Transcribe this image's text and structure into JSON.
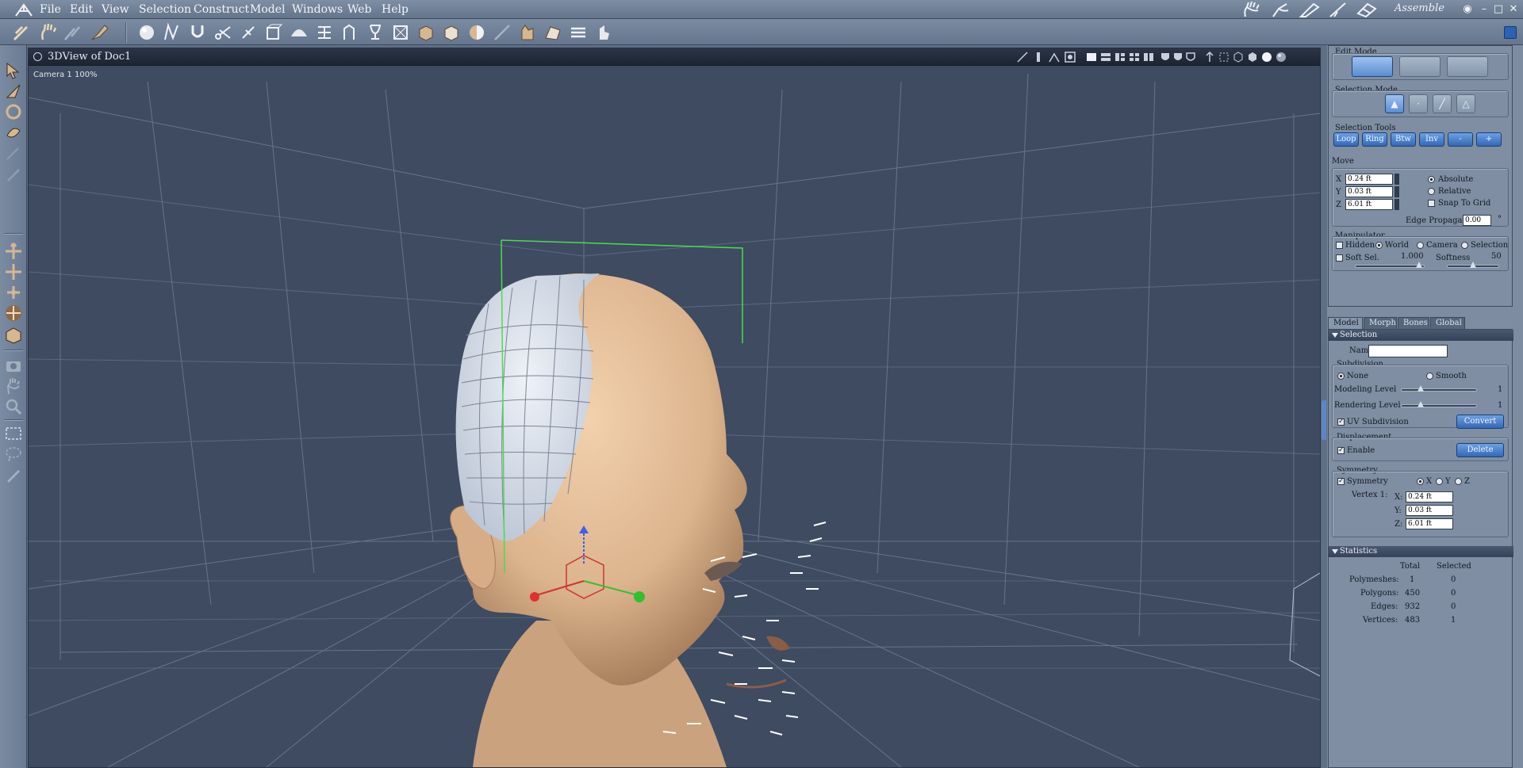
{
  "menubar": {
    "items": [
      "File",
      "Edit",
      "View",
      "Selection",
      "Construct",
      "Model",
      "Windows",
      "Web",
      "Help"
    ],
    "room_label": "Assemble",
    "room_icons": [
      "hand-icon",
      "pose-room-icon",
      "paint-room-icon",
      "material-room-icon",
      "render-room-icon"
    ]
  },
  "viewport": {
    "title": "3DView of Doc1",
    "camera_label": "Camera 1 100%"
  },
  "panel": {
    "edit_mode": {
      "title": "Edit Mode"
    },
    "selection_mode": {
      "title": "Selection Mode"
    },
    "selection_tools": {
      "title": "Selection Tools",
      "buttons": [
        "Loop",
        "Ring",
        "Btw",
        "Inv",
        "-",
        "+"
      ]
    },
    "move": {
      "title": "Move",
      "x_label": "X",
      "x_value": "0.24 ft",
      "y_label": "Y",
      "y_value": "0.03 ft",
      "z_label": "Z",
      "z_value": "6.01 ft",
      "absolute": "Absolute",
      "relative": "Relative",
      "snap": "Snap To Grid",
      "edge_prop_label": "Edge Propagation",
      "edge_prop_value": "0.00",
      "degree": "°"
    },
    "manipulator": {
      "title": "Manipulator",
      "hidden": "Hidden",
      "world": "World",
      "camera": "Camera",
      "selection": "Selection",
      "soft_sel": "Soft Sel.",
      "soft_sel_value": "1.000",
      "softness": "Softness",
      "softness_value": "50"
    },
    "tabs": [
      "Model",
      "Morph",
      "Bones",
      "Global"
    ],
    "selection_section": {
      "title": "Selection",
      "name_label": "Name",
      "name_value": ""
    },
    "subdivision": {
      "title": "Subdivision",
      "none": "None",
      "smooth": "Smooth",
      "modeling_level": "Modeling Level",
      "modeling_value": "1",
      "rendering_level": "Rendering Level",
      "rendering_value": "1",
      "uv_subdivision": "UV Subdivision",
      "convert": "Convert"
    },
    "displacement": {
      "title": "Displacement",
      "enable": "Enable",
      "delete": "Delete"
    },
    "symmetry": {
      "title": "Symmetry",
      "symmetry": "Symmetry",
      "x": "X",
      "y": "Y",
      "z": "Z",
      "vertex_label": "Vertex 1:",
      "vx_label": "X:",
      "vx_value": "0.24 ft",
      "vy_label": "Y:",
      "vy_value": "0.03 ft",
      "vz_label": "Z:",
      "vz_value": "6.01 ft"
    },
    "statistics": {
      "title": "Statistics",
      "col_total": "Total",
      "col_selected": "Selected",
      "rows": [
        {
          "label": "Polymeshes:",
          "total": "1",
          "selected": "0"
        },
        {
          "label": "Polygons:",
          "total": "450",
          "selected": "0"
        },
        {
          "label": "Edges:",
          "total": "932",
          "selected": "0"
        },
        {
          "label": "Vertices:",
          "total": "483",
          "selected": "1"
        }
      ]
    }
  },
  "colors": {
    "accent_blue": "#3568b6",
    "viewport_bg": "#3e4b61",
    "skin": "#e8c4a0",
    "bbox_green": "#4ddb4d"
  }
}
